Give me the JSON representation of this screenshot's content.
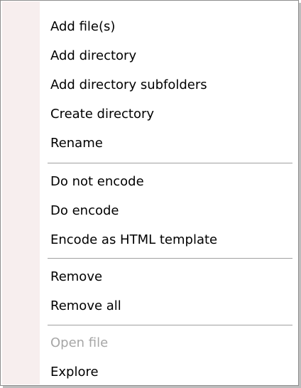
{
  "menu": {
    "items": [
      {
        "label": "Add file(s)",
        "disabled": false
      },
      {
        "label": "Add directory",
        "disabled": false
      },
      {
        "label": "Add directory subfolders",
        "disabled": false
      },
      {
        "label": "Create directory",
        "disabled": false
      },
      {
        "label": "Rename",
        "disabled": false
      },
      {
        "label": "Do not encode",
        "disabled": false
      },
      {
        "label": "Do encode",
        "disabled": false
      },
      {
        "label": "Encode as HTML template",
        "disabled": false
      },
      {
        "label": "Remove",
        "disabled": false
      },
      {
        "label": "Remove all",
        "disabled": false
      },
      {
        "label": "Open file",
        "disabled": true
      },
      {
        "label": "Explore",
        "disabled": false
      }
    ]
  }
}
